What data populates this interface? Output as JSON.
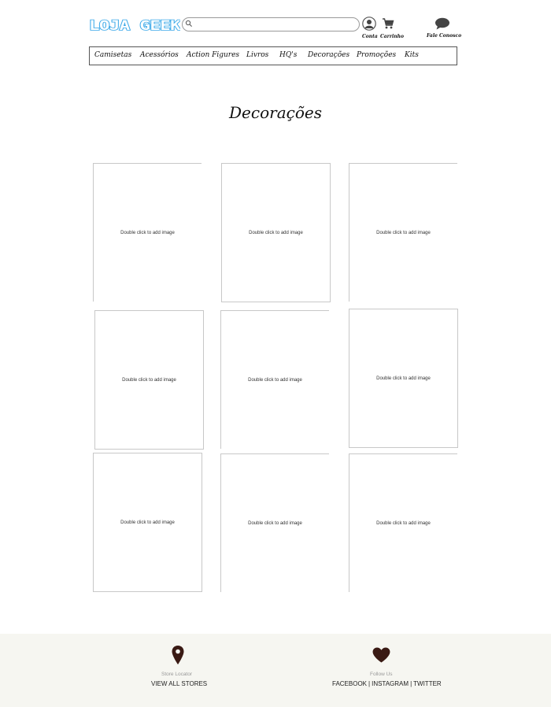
{
  "header": {
    "logo_text": "LOJA GEEK",
    "search_placeholder": "",
    "account_label": "Conta",
    "cart_label": "Carrinho",
    "contact_label": "Fale Conosco"
  },
  "nav": {
    "items": [
      "Camisetas",
      "Acessórios",
      "Action Figures",
      "Livros",
      "HQ's",
      "Decorações",
      "Promoções",
      "Kits"
    ]
  },
  "page": {
    "title": "Decorações",
    "placeholder_text": "Double click to add image"
  },
  "footer": {
    "store_caption": "Store Locator",
    "store_link": "VIEW ALL STORES",
    "follow_caption": "Follow Us",
    "social_links": [
      "FACEBOOK",
      "INSTAGRAM",
      "TWITTER"
    ]
  },
  "colors": {
    "logo": "#3aa8e8",
    "footer_bg": "#f6f6f1",
    "footer_icon": "#3a1a14"
  }
}
